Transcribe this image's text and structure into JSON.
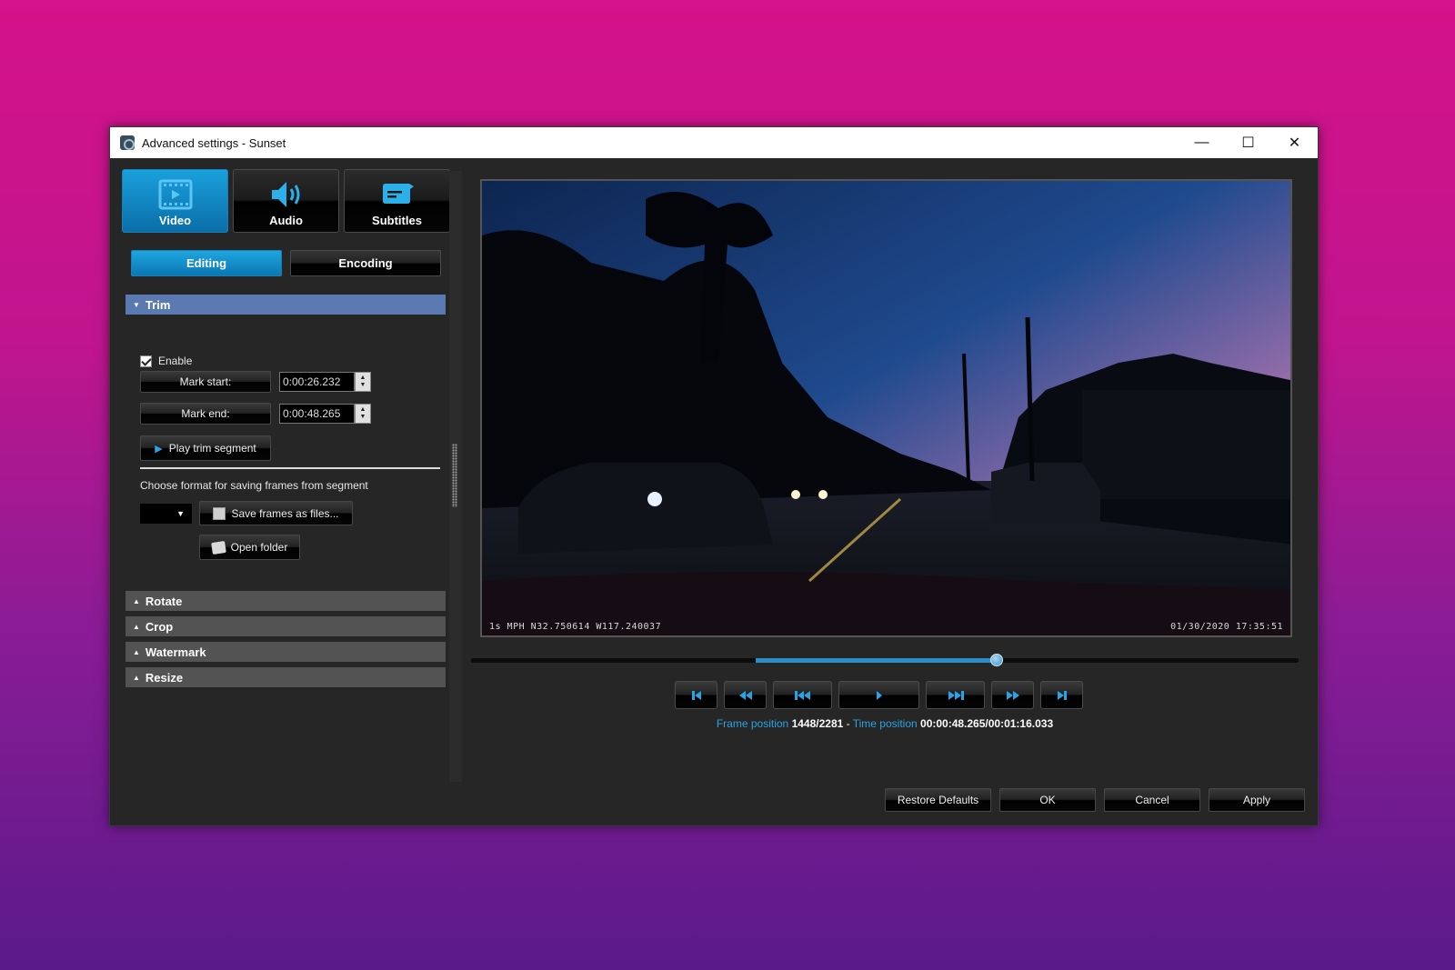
{
  "window": {
    "title": "Advanced settings - Sunset",
    "controls": {
      "minimize": "—",
      "maximize": "☐",
      "close": "✕"
    }
  },
  "colors": {
    "accent": "#1aa0dc",
    "section_open": "#5b7ab1",
    "section_closed": "#535353",
    "status_key": "#2ba3e3"
  },
  "main_tabs": [
    {
      "label": "Video",
      "icon": "film-icon",
      "active": true
    },
    {
      "label": "Audio",
      "icon": "speaker-icon",
      "active": false
    },
    {
      "label": "Subtitles",
      "icon": "speech-bubble-icon",
      "active": false
    }
  ],
  "sub_tabs": [
    {
      "label": "Editing",
      "active": true
    },
    {
      "label": "Encoding",
      "active": false
    }
  ],
  "trim": {
    "header": "Trim",
    "expanded": true,
    "enable_label": "Enable",
    "enable_checked": true,
    "mark_start_label": "Mark start:",
    "mark_start_value": "0:00:26.232",
    "mark_end_label": "Mark end:",
    "mark_end_value": "0:00:48.265",
    "play_segment_label": "Play trim segment",
    "format_caption": "Choose format for saving frames from segment",
    "format_selected": "",
    "save_frames_label": "Save frames as files...",
    "open_folder_label": "Open folder"
  },
  "collapsed_sections": [
    {
      "label": "Rotate"
    },
    {
      "label": "Crop"
    },
    {
      "label": "Watermark"
    },
    {
      "label": "Resize"
    }
  ],
  "video": {
    "osd_left": "1s MPH N32.750614 W117.240037",
    "osd_right": "01/30/2020 17:35:51"
  },
  "seek": {
    "trim_start_fraction": 0.344,
    "trim_end_fraction": 0.635,
    "position_fraction": 0.635
  },
  "transport": [
    {
      "name": "go-to-start-button",
      "icon": "skip-start-icon"
    },
    {
      "name": "step-back-button",
      "icon": "rewind-icon"
    },
    {
      "name": "previous-frame-button",
      "icon": "previous-icon"
    },
    {
      "name": "play-button",
      "icon": "play-icon"
    },
    {
      "name": "next-frame-button",
      "icon": "next-icon"
    },
    {
      "name": "step-forward-button",
      "icon": "fast-forward-icon"
    },
    {
      "name": "go-to-end-button",
      "icon": "skip-end-icon"
    }
  ],
  "status": {
    "frame_label": "Frame position",
    "frame_value": "1448/2281",
    "separator": " - ",
    "time_label": "Time position",
    "time_value": "00:00:48.265/00:01:16.033"
  },
  "footer": {
    "restore_defaults": "Restore Defaults",
    "ok": "OK",
    "cancel": "Cancel",
    "apply": "Apply"
  }
}
